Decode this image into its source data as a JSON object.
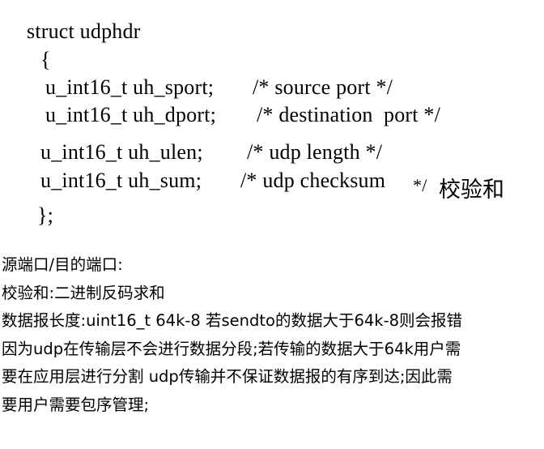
{
  "code": {
    "line1": "struct udphdr",
    "open_brace": "{",
    "sport_decl": "u_int16_t uh_sport;",
    "sport_comment": "/* source port */",
    "dport_decl": "u_int16_t uh_dport;",
    "dport_comment": "/* destination  port */",
    "ulen_decl": "u_int16_t uh_ulen;",
    "ulen_comment": "/* udp length */",
    "sum_decl": "u_int16_t uh_sum;",
    "sum_comment": "/* udp checksum",
    "sum_comment_end": "*/",
    "sum_note": "校验和",
    "close_brace": "};"
  },
  "notes": [
    "源端口/目的端口:",
    "校验和:二进制反码求和",
    "数据报长度:uint16_t 64k-8 若sendto的数据大于64k-8则会报错",
    "因为udp在传输层不会进行数据分段;若传输的数据大于64k用户需",
    "要在应用层进行分割 udp传输并不保证数据报的有序到达;因此需",
    "要用户需要包序管理;"
  ]
}
